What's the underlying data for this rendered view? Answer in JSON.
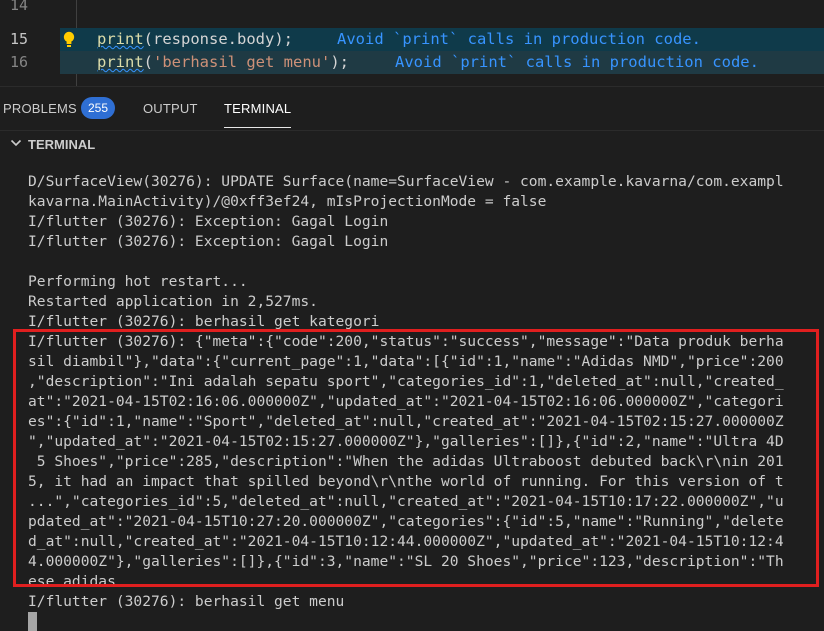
{
  "editor": {
    "lines": [
      {
        "number": "14",
        "code_pre": "",
        "code_str": "",
        "code_post": "",
        "hint": ""
      },
      {
        "number": "15",
        "fn": "print",
        "arg": "response.body",
        "suffix": ");",
        "hint": "Avoid `print` calls in production code."
      },
      {
        "number": "16",
        "fn": "print",
        "arg_str": "'berhasil get menu'",
        "suffix": ");",
        "hint": "Avoid `print` calls in production code."
      }
    ]
  },
  "panel": {
    "tabs": [
      {
        "label": "PROBLEMS"
      },
      {
        "label": "OUTPUT"
      },
      {
        "label": "TERMINAL"
      }
    ],
    "problems_count": "255",
    "section_title": "TERMINAL"
  },
  "terminal": {
    "lines": [
      "D/SurfaceView(30276): UPDATE Surface(name=SurfaceView - com.example.kavarna/com.exampl",
      "kavarna.MainActivity)/@0xff3ef24, mIsProjectionMode = false",
      "I/flutter (30276): Exception: Gagal Login",
      "I/flutter (30276): Exception: Gagal Login",
      "",
      "Performing hot restart...",
      "Restarted application in 2,527ms.",
      "I/flutter (30276): berhasil get kategori",
      "I/flutter (30276): {\"meta\":{\"code\":200,\"status\":\"success\",\"message\":\"Data produk berha",
      "sil diambil\"},\"data\":{\"current_page\":1,\"data\":[{\"id\":1,\"name\":\"Adidas NMD\",\"price\":200",
      ",\"description\":\"Ini adalah sepatu sport\",\"categories_id\":1,\"deleted_at\":null,\"created_",
      "at\":\"2021-04-15T02:16:06.000000Z\",\"updated_at\":\"2021-04-15T02:16:06.000000Z\",\"categori",
      "es\":{\"id\":1,\"name\":\"Sport\",\"deleted_at\":null,\"created_at\":\"2021-04-15T02:15:27.000000Z",
      "\",\"updated_at\":\"2021-04-15T02:15:27.000000Z\"},\"galleries\":[]},{\"id\":2,\"name\":\"Ultra 4D",
      " 5 Shoes\",\"price\":285,\"description\":\"When the adidas Ultraboost debuted back\\r\\nin 201",
      "5, it had an impact that spilled beyond\\r\\nthe world of running. For this version of t",
      "...\",\"categories_id\":5,\"deleted_at\":null,\"created_at\":\"2021-04-15T10:17:22.000000Z\",\"u",
      "pdated_at\":\"2021-04-15T10:27:20.000000Z\",\"categories\":{\"id\":5,\"name\":\"Running\",\"delete",
      "d_at\":null,\"created_at\":\"2021-04-15T10:12:44.000000Z\",\"updated_at\":\"2021-04-15T10:12:4",
      "4.000000Z\"},\"galleries\":[]},{\"id\":3,\"name\":\"SL 20 Shoes\",\"price\":123,\"description\":\"Th",
      "ese adidas",
      "I/flutter (30276): berhasil get menu"
    ]
  },
  "colors": {
    "highlight_box": "#e01f1f",
    "badge": "#2f6fd4",
    "hint": "#3794ff"
  }
}
